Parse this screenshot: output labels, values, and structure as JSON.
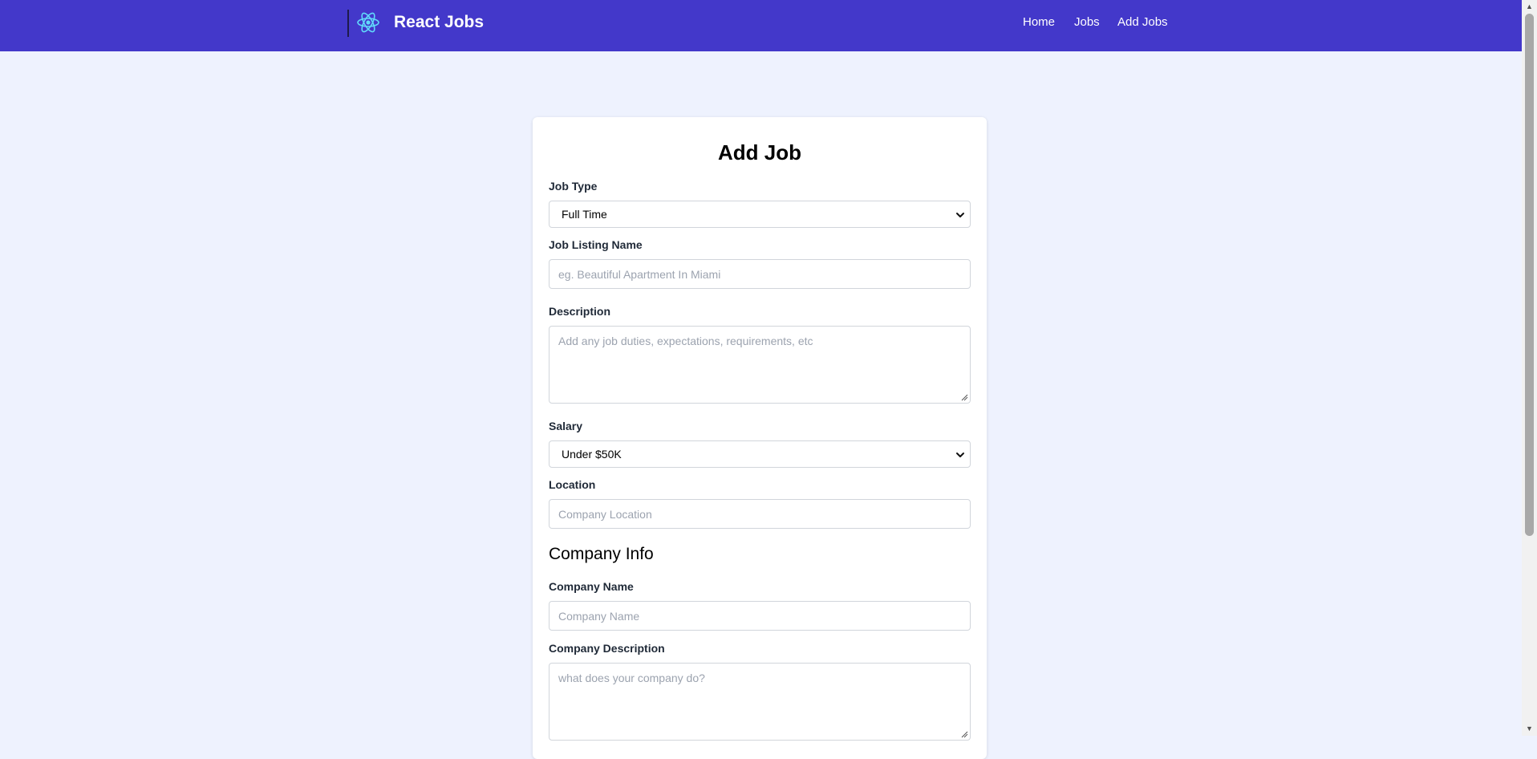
{
  "navbar": {
    "brand": "React Jobs",
    "logo_icon": "react-atom-icon",
    "links": [
      {
        "label": "Home"
      },
      {
        "label": "Jobs"
      },
      {
        "label": "Add Jobs"
      }
    ],
    "background": "#4338ca"
  },
  "form": {
    "title": "Add Job",
    "job_type": {
      "label": "Job Type",
      "selected": "Full Time"
    },
    "job_listing_name": {
      "label": "Job Listing Name",
      "placeholder": "eg. Beautiful Apartment In Miami"
    },
    "description": {
      "label": "Description",
      "placeholder": "Add any job duties, expectations, requirements, etc"
    },
    "salary": {
      "label": "Salary",
      "selected": "Under $50K"
    },
    "location": {
      "label": "Location",
      "placeholder": "Company Location"
    },
    "company_info": {
      "heading": "Company Info",
      "company_name": {
        "label": "Company Name",
        "placeholder": "Company Name"
      },
      "company_description": {
        "label": "Company Description",
        "placeholder": "what does your company do?"
      }
    }
  },
  "colors": {
    "page_background": "#eef2fe",
    "accent": "#4338ca",
    "logo": "#61dafb"
  }
}
